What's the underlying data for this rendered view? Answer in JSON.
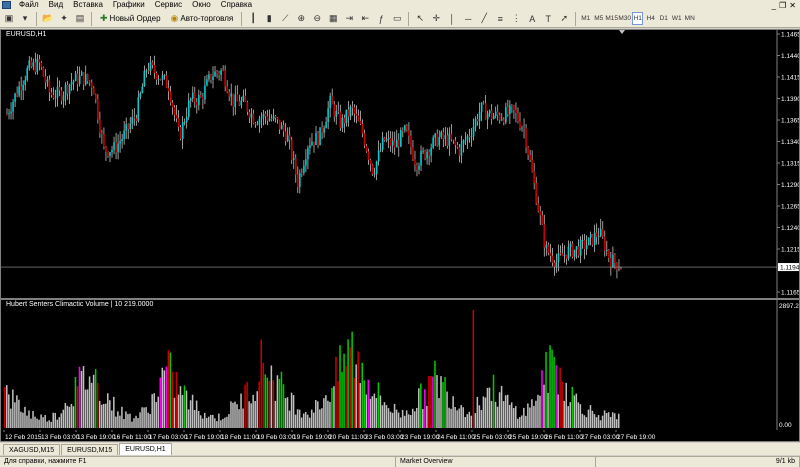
{
  "menu": {
    "items": [
      "Файл",
      "Вид",
      "Вставка",
      "Графики",
      "Сервис",
      "Окно",
      "Справка"
    ]
  },
  "toolbar": {
    "new_order_label": "Новый Ордер",
    "auto_trading_label": "Авто-торговля",
    "timeframes": [
      "M1",
      "M5",
      "M15",
      "M30",
      "H1",
      "H4",
      "D1",
      "W1",
      "MN"
    ],
    "active_timeframe": "H1"
  },
  "chart": {
    "title": "EURUSD,H1",
    "current_price": "1.1194",
    "price_labels": [
      "1.1465",
      "1.1440",
      "1.1415",
      "1.1390",
      "1.1365",
      "1.1340",
      "1.1315",
      "1.1290",
      "1.1265",
      "1.1240",
      "1.1215",
      "1.1165"
    ],
    "colors": {
      "background": "#000000",
      "bull": "#00ced1",
      "bear": "#cc0000",
      "wick": "#ffffff",
      "grid": "#808080"
    }
  },
  "indicator": {
    "title": "Hubert Senters Climactic Volume | 10 219.0000",
    "max_label": "2897.25",
    "min_label": "0.00"
  },
  "time_axis": {
    "labels": [
      "12 Feb 2015",
      "13 Feb 03:00",
      "13 Feb 19:00",
      "16 Feb 11:00",
      "17 Feb 03:00",
      "17 Feb 19:00",
      "18 Feb 11:00",
      "19 Feb 03:00",
      "19 Feb 19:00",
      "20 Feb 11:00",
      "23 Feb 03:00",
      "23 Feb 19:00",
      "24 Feb 11:00",
      "25 Feb 03:00",
      "25 Feb 19:00",
      "26 Feb 11:00",
      "27 Feb 03:00",
      "27 Feb 19:00"
    ]
  },
  "tabs": [
    {
      "label": "XAGUSD,M15",
      "active": false
    },
    {
      "label": "EURUSD,M15",
      "active": false
    },
    {
      "label": "EURUSD,H1",
      "active": true
    }
  ],
  "statusbar": {
    "help": "Для справки, нажмите F1",
    "profile": "Market Overview",
    "traffic": "9/1 kb"
  },
  "chart_data": {
    "type": "candlestick",
    "y_range": [
      1.1165,
      1.1465
    ],
    "volume_range": [
      0,
      2897.25
    ],
    "close_path": [
      1.1372,
      1.14,
      1.1425,
      1.143,
      1.1395,
      1.1395,
      1.141,
      1.1415,
      1.1406,
      1.133,
      1.1332,
      1.135,
      1.1372,
      1.1428,
      1.1418,
      1.1405,
      1.1345,
      1.1388,
      1.139,
      1.1418,
      1.1422,
      1.1386,
      1.1385,
      1.1366,
      1.137,
      1.1363,
      1.1347,
      1.1293,
      1.134,
      1.1345,
      1.1385,
      1.136,
      1.1378,
      1.135,
      1.1305,
      1.1342,
      1.1335,
      1.1352,
      1.1315,
      1.133,
      1.1344,
      1.1342,
      1.133,
      1.135,
      1.1378,
      1.137,
      1.137,
      1.1375,
      1.1355,
      1.1285,
      1.1215,
      1.12,
      1.1212,
      1.1215,
      1.1222,
      1.1235,
      1.1203,
      1.1195
    ],
    "volume_pattern": [
      0.3,
      0.22,
      0.14,
      0.1,
      0.08,
      0.12,
      0.26,
      0.38,
      0.46,
      0.33,
      0.2,
      0.12,
      0.09,
      0.14,
      0.28,
      0.5,
      0.36,
      0.24,
      0.16,
      0.1,
      0.09,
      0.16,
      0.24,
      0.36,
      0.58,
      0.42,
      0.3,
      0.2,
      0.13,
      0.18,
      0.3,
      0.46,
      0.68,
      0.52,
      0.36,
      0.24,
      0.16,
      0.12,
      0.2,
      0.3,
      0.42,
      0.33,
      0.22,
      0.15,
      0.22,
      0.34,
      0.28,
      0.18,
      0.12,
      0.2,
      0.42,
      0.55,
      0.36,
      0.24,
      0.16,
      0.12,
      0.1,
      0.09
    ],
    "volume_colors": {
      "normal": "#c0c0c0",
      "climax_high": "#cc0000",
      "climax_green": "#00cc00",
      "magenta": "#ff00ff"
    }
  }
}
